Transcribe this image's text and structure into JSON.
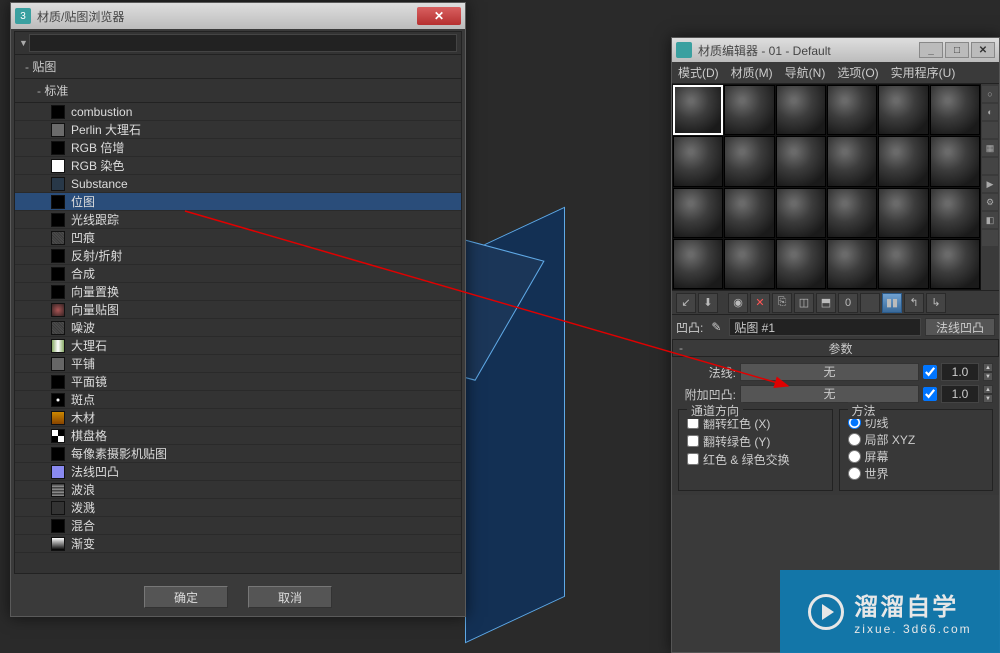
{
  "browser": {
    "title": "材质/贴图浏览器",
    "search_placeholder": "",
    "group1": "贴图",
    "group2": "标准",
    "items": [
      {
        "label": "combustion",
        "sw": "sw-black"
      },
      {
        "label": "Perlin 大理石",
        "sw": "sw-perlin"
      },
      {
        "label": "RGB 倍增",
        "sw": "sw-black"
      },
      {
        "label": "RGB 染色",
        "sw": "sw-white"
      },
      {
        "label": "Substance",
        "sw": "sw-blue"
      },
      {
        "label": "位图",
        "sw": "sw-black",
        "selected": true
      },
      {
        "label": "光线跟踪",
        "sw": "sw-black"
      },
      {
        "label": "凹痕",
        "sw": "sw-noise"
      },
      {
        "label": "反射/折射",
        "sw": "sw-black"
      },
      {
        "label": "合成",
        "sw": "sw-black"
      },
      {
        "label": "向量置换",
        "sw": "sw-black"
      },
      {
        "label": "向量贴图",
        "sw": "sw-dir"
      },
      {
        "label": "噪波",
        "sw": "sw-noise"
      },
      {
        "label": "大理石",
        "sw": "sw-marble"
      },
      {
        "label": "平铺",
        "sw": "sw-tile"
      },
      {
        "label": "平面镜",
        "sw": "sw-black"
      },
      {
        "label": "斑点",
        "sw": "sw-speckle"
      },
      {
        "label": "木材",
        "sw": "sw-wood"
      },
      {
        "label": "棋盘格",
        "sw": "sw-checker"
      },
      {
        "label": "每像素摄影机贴图",
        "sw": "sw-black"
      },
      {
        "label": "法线凹凸",
        "sw": "sw-normal"
      },
      {
        "label": "波浪",
        "sw": "sw-wave"
      },
      {
        "label": "泼溅",
        "sw": "sw-splat"
      },
      {
        "label": "混合",
        "sw": "sw-black"
      },
      {
        "label": "渐变",
        "sw": "sw-gradient"
      }
    ],
    "ok": "确定",
    "cancel": "取消"
  },
  "editor": {
    "title": "材质编辑器 - 01 - Default",
    "menu": {
      "mode": "模式(D)",
      "material": "材质(M)",
      "nav": "导航(N)",
      "options": "选项(O)",
      "util": "实用程序(U)"
    },
    "bump_label": "凹凸:",
    "map_name": "贴图 #1",
    "type_label": "法线凹凸",
    "rollup_title": "参数",
    "normal_label": "法线:",
    "normal_slot": "无",
    "normal_val": "1.0",
    "addbump_label": "附加凹凸:",
    "addbump_slot": "无",
    "addbump_val": "1.0",
    "channel_group": "通道方向",
    "flip_red": "翻转红色 (X)",
    "flip_green": "翻转绿色 (Y)",
    "swap_rg": "红色 & 绿色交换",
    "method_group": "方法",
    "m_tangent": "切线",
    "m_local": "局部 XYZ",
    "m_screen": "屏幕",
    "m_world": "世界"
  },
  "watermark": {
    "big": "溜溜自学",
    "small": "zixue. 3d66.com"
  }
}
